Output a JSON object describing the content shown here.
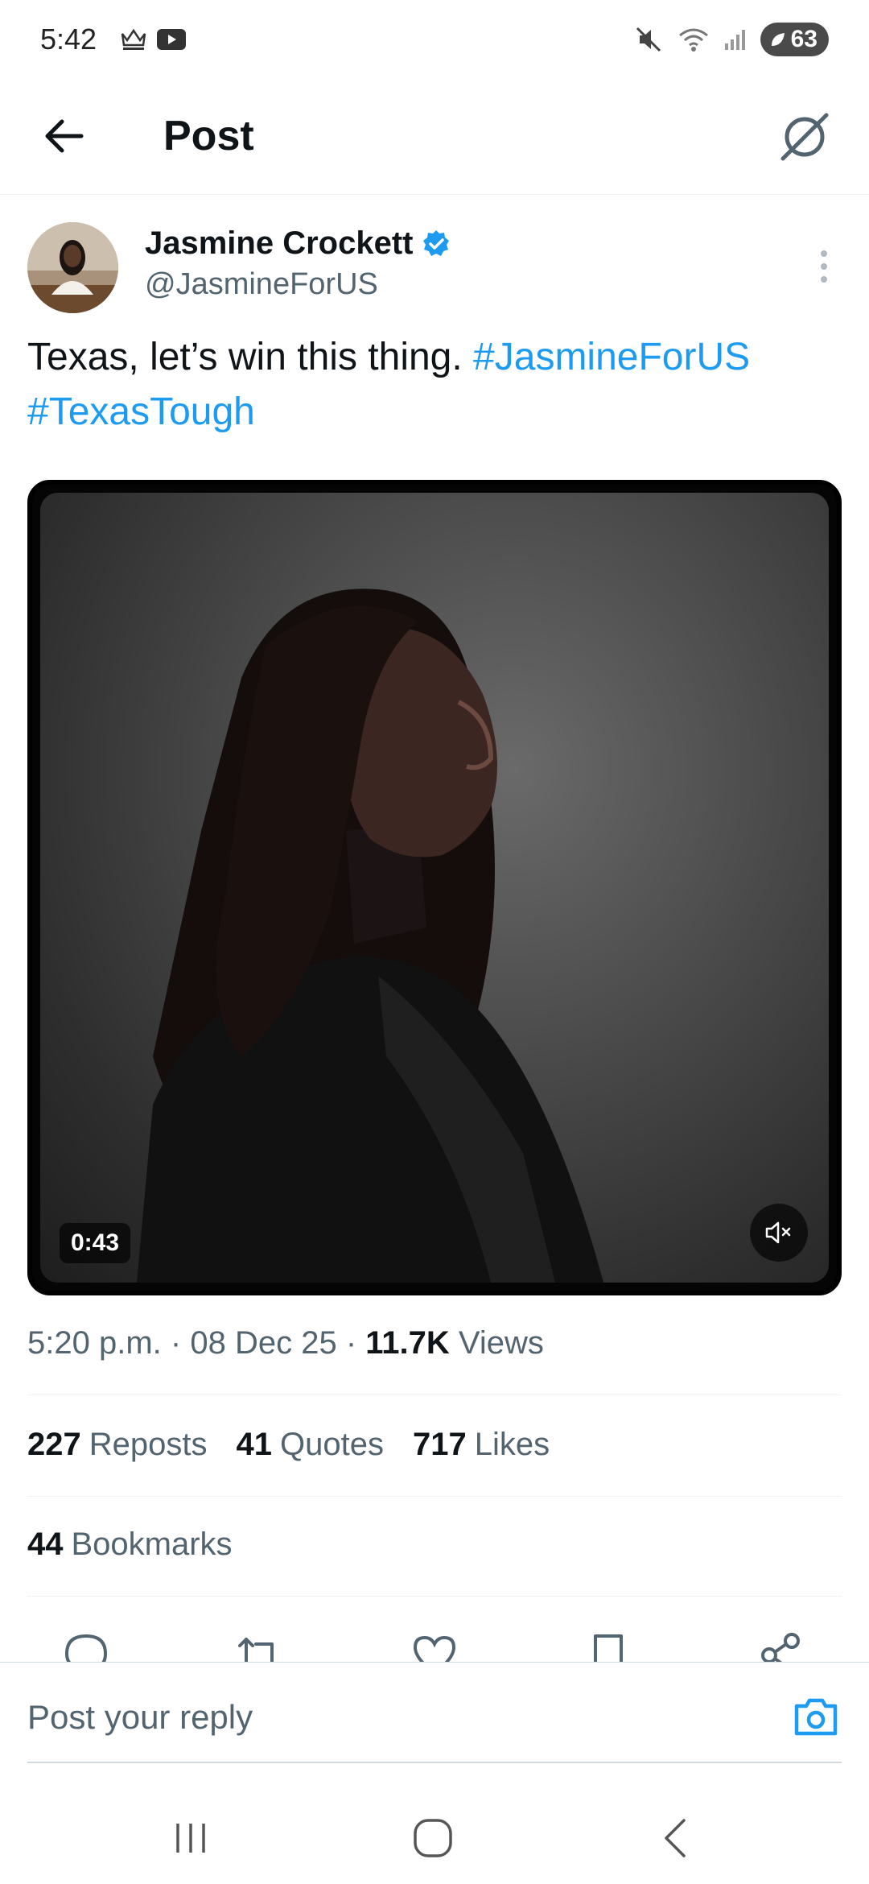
{
  "status_bar": {
    "time": "5:42",
    "battery": "63",
    "icons": [
      "crown-icon",
      "youtube-icon",
      "mute-icon",
      "wifi-icon",
      "signal-icon",
      "battery-icon"
    ]
  },
  "header": {
    "title": "Post",
    "back_icon": "arrow-left-icon",
    "grok_icon": "grok-icon"
  },
  "post": {
    "author_name": "Jasmine Crockett",
    "handle": "@JasmineForUS",
    "verified": true,
    "text_plain": "Texas, let’s win this thing.",
    "hashtag_1": "#JasmineForUS",
    "hashtag_2": "#TexasTough",
    "video_duration": "0:43",
    "time": "5:20 p.m.",
    "date": "08 Dec 25",
    "separator": "·",
    "views_count": "11.7K",
    "views_label": "Views"
  },
  "stats": {
    "reposts_count": "227",
    "reposts_label": "Reposts",
    "quotes_count": "41",
    "quotes_label": "Quotes",
    "likes_count": "717",
    "likes_label": "Likes",
    "bookmarks_count": "44",
    "bookmarks_label": "Bookmarks"
  },
  "actions": [
    "reply-icon",
    "repost-icon",
    "like-icon",
    "bookmark-icon",
    "share-icon"
  ],
  "reply_bar": {
    "placeholder": "Post your reply",
    "camera_icon": "camera-icon"
  },
  "colors": {
    "accent": "#1d9bf0",
    "text": "#0f1419",
    "secondary": "#536471"
  }
}
